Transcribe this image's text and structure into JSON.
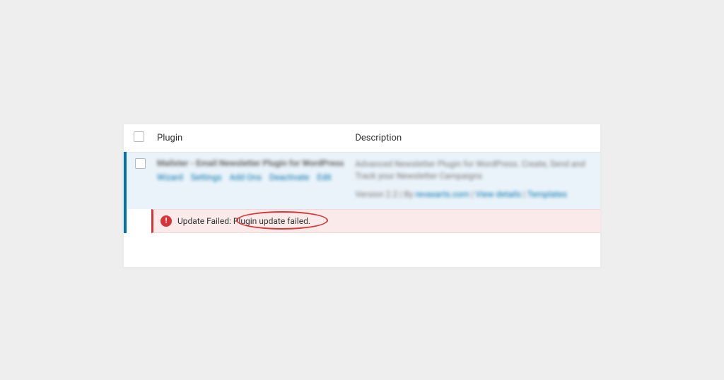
{
  "table": {
    "headers": {
      "plugin": "Plugin",
      "description": "Description"
    }
  },
  "plugin_row": {
    "name": "Mailster - Email Newsletter Plugin for WordPress",
    "actions": {
      "a1": "Wizard",
      "a2": "Settings",
      "a3": "Add Ons",
      "a4": "Deactivate",
      "a5": "Edit"
    },
    "description": "Advanced Newsletter Plugin for WordPress. Create, Send and Track your Newsletter Campaigns",
    "meta": {
      "version_prefix": "Version 2.2 | By ",
      "by": "revaxarts.com",
      "sep1": " | ",
      "view_details": "View details",
      "sep2": " | ",
      "templates": "Templates"
    }
  },
  "error": {
    "text": "Update Failed: Plugin update failed."
  }
}
